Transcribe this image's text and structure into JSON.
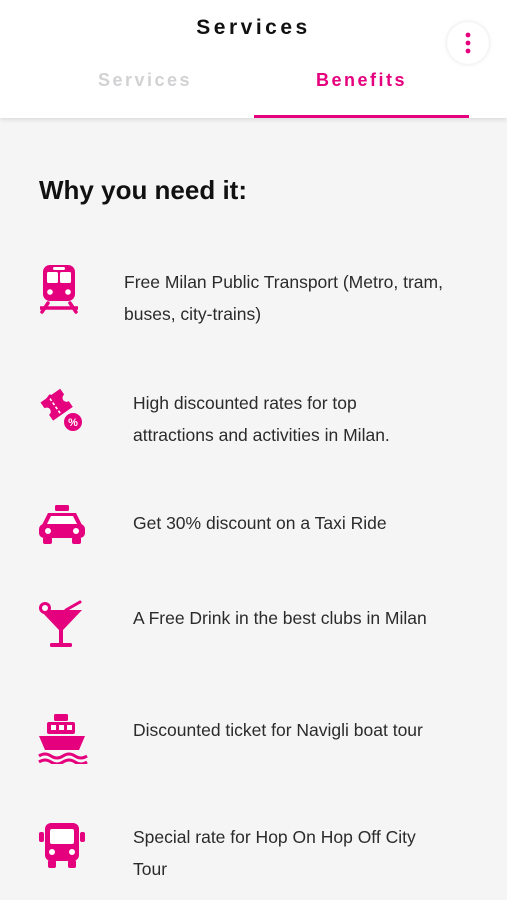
{
  "header": {
    "title": "Services",
    "tabs": [
      {
        "label": "Services",
        "active": false
      },
      {
        "label": "Benefits",
        "active": true
      }
    ]
  },
  "colors": {
    "accent": "#e5007e",
    "inactive_tab": "#d2d2d4",
    "background": "#f5f5f6"
  },
  "section": {
    "title": "Why you need it:"
  },
  "benefits": [
    {
      "icon": "train-icon",
      "line1": "Free Milan Public Transport (Metro, tram,",
      "line2": "buses, city-trains)"
    },
    {
      "icon": "discount-ticket-icon",
      "line1": "High discounted rates for top",
      "line2": "attractions and activities in Milan."
    },
    {
      "icon": "taxi-icon",
      "line1": "Get 30% discount on a Taxi Ride",
      "line2": ""
    },
    {
      "icon": "cocktail-icon",
      "line1": "A Free Drink in the best clubs in Milan",
      "line2": ""
    },
    {
      "icon": "boat-icon",
      "line1": "Discounted ticket for Navigli boat tour",
      "line2": ""
    },
    {
      "icon": "bus-icon",
      "line1": "Special rate for Hop On Hop Off City",
      "line2": "Tour"
    }
  ]
}
